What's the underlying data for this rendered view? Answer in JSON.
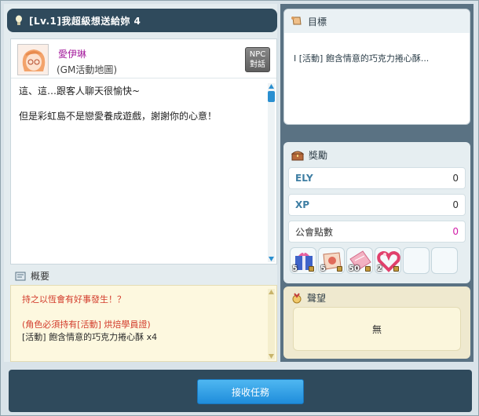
{
  "window": {
    "title": "[Lv.1]我超級想送給妳 4"
  },
  "npc": {
    "name": "愛伊琳",
    "location": "(GM活動地圖)",
    "talk_button": [
      "NPC",
      "對話"
    ],
    "dialogue": [
      "這、這…跟客人聊天很愉快~",
      "但是彩虹島不是戀愛養成遊戲，謝謝你的心意！"
    ]
  },
  "summary": {
    "header": "概要",
    "lines": [
      {
        "text": "持之以恆會有好事發生！？",
        "style": "red"
      },
      {
        "text": "",
        "style": "red"
      },
      {
        "text": "(角色必須持有[活動] 烘焙學員證)",
        "style": "red"
      },
      {
        "text": "[活動] 飽含情意的巧克力捲心酥 x4",
        "style": "dark"
      }
    ]
  },
  "goal": {
    "header": "目標",
    "item": "I  [活動] 飽含情意的巧克力捲心酥..."
  },
  "reward": {
    "header": "獎勵",
    "rows": [
      {
        "label": "ELY",
        "value": "0"
      },
      {
        "label": "XP",
        "value": "0"
      },
      {
        "label": "公會點數",
        "value": "0"
      }
    ],
    "items": [
      {
        "icon": "gift-box-icon",
        "count": "5"
      },
      {
        "icon": "scroll-coupon-icon",
        "count": "5"
      },
      {
        "icon": "pink-ticket-icon",
        "count": "50"
      },
      {
        "icon": "heart-wreath-icon",
        "count": "2"
      },
      {
        "icon": "empty-slot",
        "count": ""
      },
      {
        "icon": "empty-slot",
        "count": ""
      }
    ]
  },
  "fame": {
    "header": "聲望",
    "value": "無"
  },
  "actions": {
    "accept": "接收任務"
  },
  "colors": {
    "title_bar": "#2f4a5c",
    "accent_blue": "#1f8ddb",
    "npc_name": "#a3189b",
    "summary_red": "#d33c2c",
    "guild_points": "#d11da8"
  }
}
